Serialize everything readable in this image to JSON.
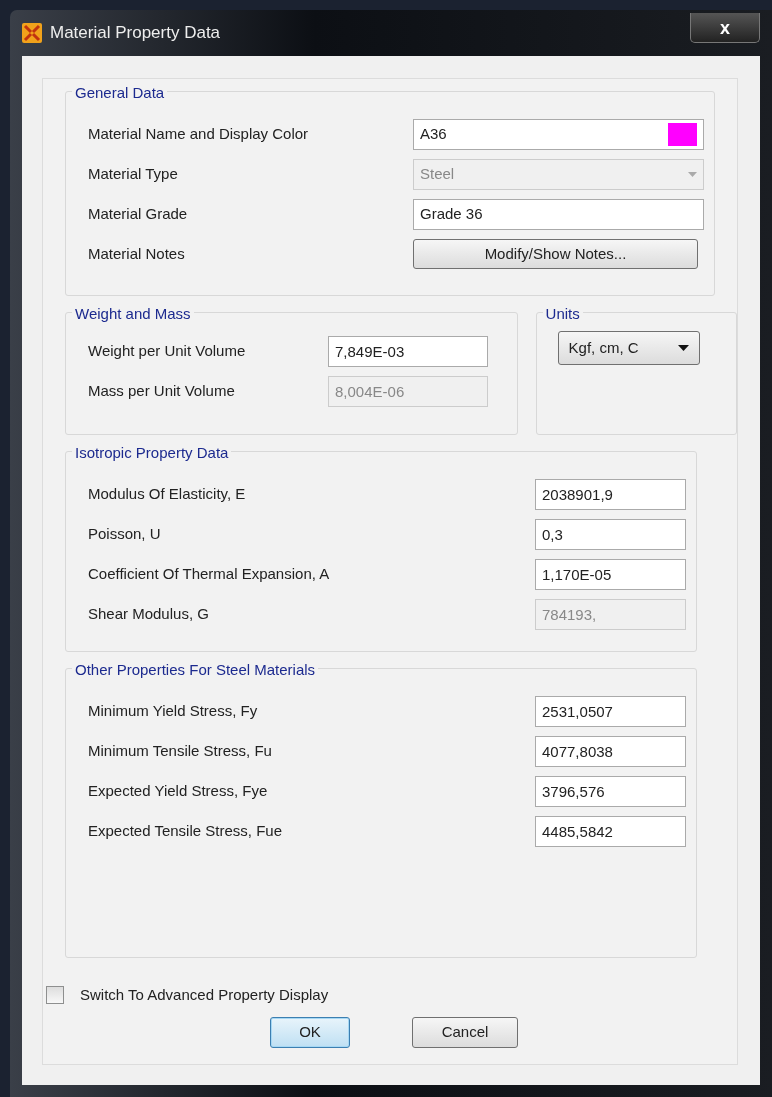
{
  "window": {
    "title": "Material Property Data",
    "close_label": "x"
  },
  "general": {
    "title": "General Data",
    "rows": [
      {
        "kind": "text",
        "label": "Material Name and Display Color",
        "value": "A36",
        "disabled": false,
        "color": "#ff00ff"
      },
      {
        "kind": "select",
        "label": "Material Type",
        "value": "Steel",
        "disabled": true
      },
      {
        "kind": "text",
        "label": "Material Grade",
        "value": "Grade 36",
        "disabled": false
      },
      {
        "kind": "button",
        "label": "Material Notes",
        "value": "Modify/Show Notes..."
      }
    ]
  },
  "weight": {
    "title": "Weight and Mass",
    "rows": [
      {
        "label": "Weight per Unit Volume",
        "value": "7,849E-03",
        "disabled": false
      },
      {
        "label": "Mass per Unit Volume",
        "value": "8,004E-06",
        "disabled": true
      }
    ]
  },
  "units": {
    "title": "Units",
    "value": "Kgf, cm, C"
  },
  "isotropic": {
    "title": "Isotropic Property Data",
    "rows": [
      {
        "label": "Modulus Of Elasticity,  E",
        "value": "2038901,9",
        "disabled": false
      },
      {
        "label": "Poisson,  U",
        "value": "0,3",
        "disabled": false
      },
      {
        "label": "Coefficient Of Thermal Expansion,  A",
        "value": "1,170E-05",
        "disabled": false
      },
      {
        "label": "Shear Modulus,  G",
        "value": "784193,",
        "disabled": true
      }
    ]
  },
  "steel": {
    "title": "Other Properties For Steel Materials",
    "rows": [
      {
        "label": "Minimum Yield Stress, Fy",
        "value": "2531,0507",
        "disabled": false
      },
      {
        "label": "Minimum Tensile Stress, Fu",
        "value": "4077,8038",
        "disabled": false
      },
      {
        "label": "Expected Yield Stress, Fye",
        "value": "3796,576",
        "disabled": false
      },
      {
        "label": "Expected Tensile Stress, Fue",
        "value": "4485,5842",
        "disabled": false
      }
    ]
  },
  "advanced": {
    "label": "Switch To Advanced Property Display",
    "checked": false
  },
  "buttons": [
    {
      "label": "OK",
      "default": true
    },
    {
      "label": "Cancel",
      "default": false
    }
  ]
}
